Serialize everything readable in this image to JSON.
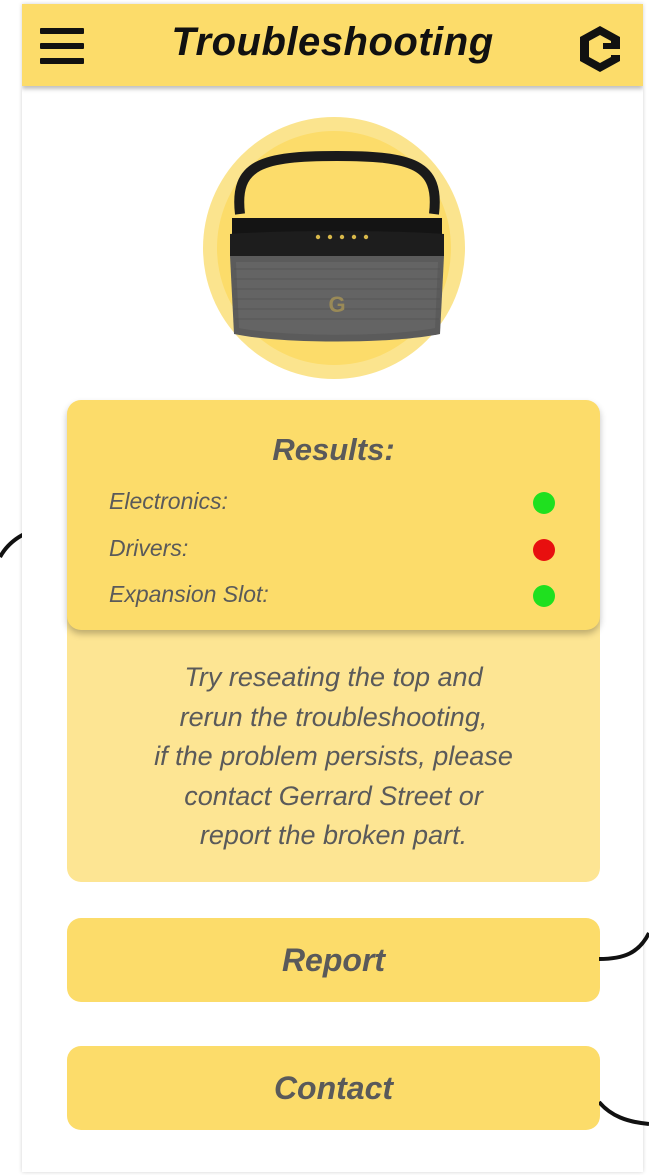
{
  "header": {
    "title": "Troubleshooting",
    "menu_icon": "hamburger-menu-icon",
    "logo_icon": "brand-g-logo-icon",
    "color": "#fcdc6a"
  },
  "product": {
    "image": "portable-speaker-image",
    "logo_letter": "G"
  },
  "results": {
    "title": "Results:",
    "items": [
      {
        "label": "Electronics:",
        "status": "ok",
        "color": "#1fe01f"
      },
      {
        "label": "Drivers:",
        "status": "fail",
        "color": "#e80f0f"
      },
      {
        "label": "Expansion Slot:",
        "status": "ok",
        "color": "#1fe01f"
      }
    ]
  },
  "message": {
    "lines": [
      "Try reseating the top and",
      "rerun the troubleshooting,",
      "if the problem persists, please",
      "contact Gerrard Street or",
      "report the broken part."
    ]
  },
  "buttons": {
    "report_label": "Report",
    "contact_label": "Contact"
  },
  "colors": {
    "accent": "#fcdc6a",
    "accent_light": "#fde593",
    "text_muted": "#5a5a5a"
  }
}
